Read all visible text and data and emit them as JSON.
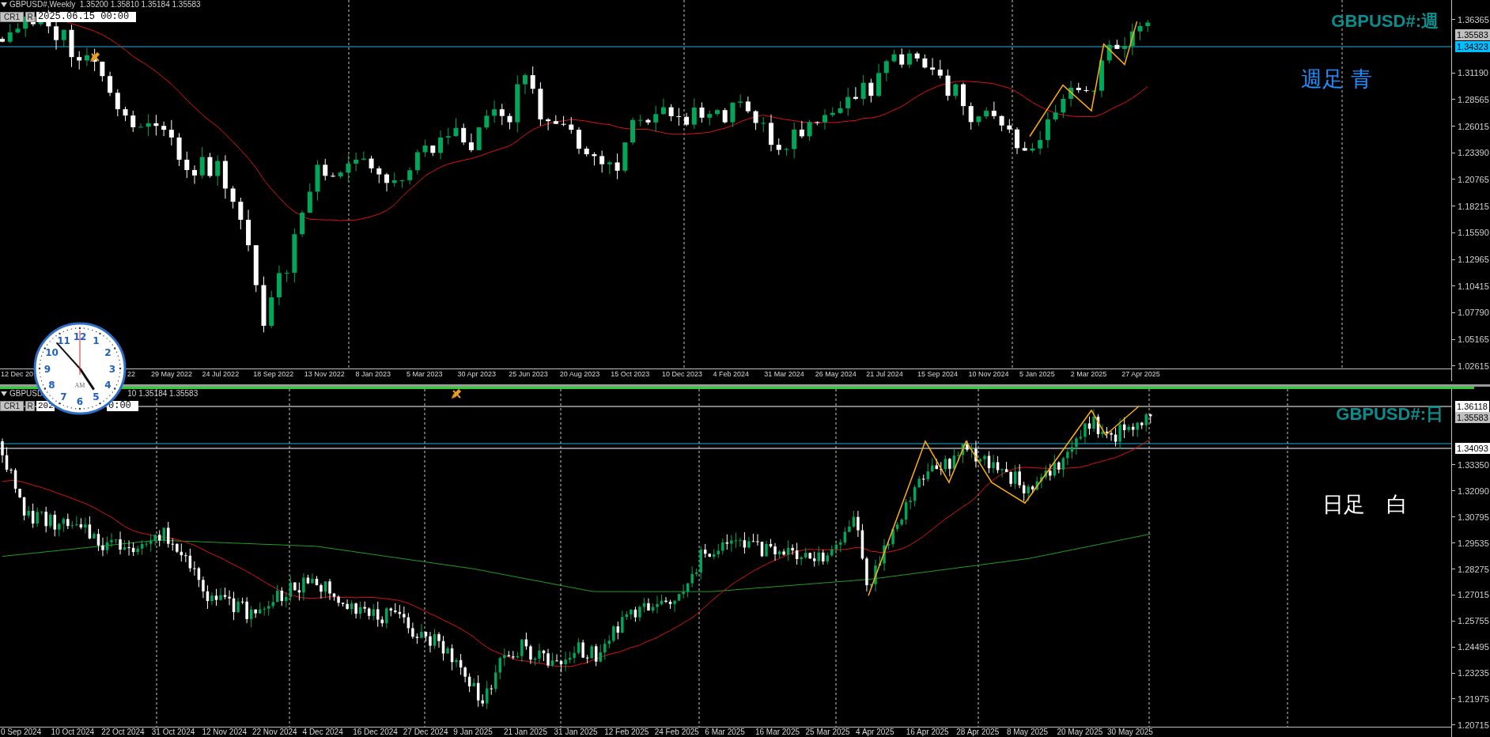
{
  "top_chart": {
    "header": "GBPUSD#,Weekly  1.35200 1.35810 1.35184 1.35583",
    "buttons": [
      "CR1",
      "R"
    ],
    "date_field": "2025.06.15 00:00",
    "symbol_label": "GBPUSD#:週",
    "note": "週足 青",
    "price_ticks": [
      "1.36365",
      "1.31190",
      "1.28565",
      "1.26015",
      "1.23390",
      "1.20765",
      "1.18215",
      "1.15590",
      "1.12965",
      "1.10415",
      "1.07790",
      "1.05165",
      "1.02615"
    ],
    "price_badges": [
      {
        "text": "1.35583",
        "kind": "bid"
      },
      {
        "text": "1.34323",
        "kind": "line"
      }
    ],
    "time_labels": [
      "12 Dec 20",
      "22",
      "29 May 2022",
      "24 Jul 2022",
      "18 Sep 2022",
      "13 Nov 2022",
      "8 Jan 2023",
      "5 Mar 2023",
      "30 Apr 2023",
      "25 Jun 2023",
      "20 Aug 2023",
      "15 Oct 2023",
      "10 Dec 2023",
      "4 Feb 2024",
      "31 Mar 2024",
      "26 May 2024",
      "21 Jul 2024",
      "15 Sep 2024",
      "10 Nov 2024",
      "5 Jan 2025",
      "2 Mar 2025",
      "27 Apr 2025"
    ]
  },
  "bottom_chart": {
    "header_parts": [
      "GBPUSD",
      "10 1.35184 1.35583"
    ],
    "buttons": [
      "CR1",
      "R"
    ],
    "date_parts": [
      "202",
      "0:00"
    ],
    "symbol_label": "GBPUSD#:日",
    "note": "日足　白",
    "price_ticks": [
      "1.33350",
      "1.32090",
      "1.30795",
      "1.29535",
      "1.28275",
      "1.27015",
      "1.25755",
      "1.24495",
      "1.23235",
      "1.21975",
      "1.20715"
    ],
    "price_badges": [
      {
        "text": "1.36118",
        "kind": "level"
      },
      {
        "text": "1.35583",
        "kind": "bid"
      },
      {
        "text": "1.34093",
        "kind": "level"
      }
    ],
    "time_labels": [
      "0 Sep 2024",
      "10 Oct 2024",
      "22 Oct 2024",
      "31 Oct 2024",
      "12 Nov 2024",
      "22 Nov 2024",
      "4 Dec 2024",
      "16 Dec 2024",
      "27 Dec 2024",
      "9 Jan 2025",
      "21 Jan 2025",
      "31 Jan 2025",
      "12 Feb 2025",
      "24 Feb 2025",
      "6 Mar 2025",
      "16 Mar 2025",
      "25 Mar 2025",
      "4 Apr 2025",
      "16 Apr 2025",
      "28 Apr 2025",
      "8 May 2025",
      "20 May 2025",
      "30 May 2025"
    ]
  },
  "clock": {
    "numerals": [
      "12",
      "11",
      "1",
      "10",
      "2",
      "9",
      "3",
      "8",
      "4",
      "7",
      "5",
      "6"
    ],
    "period": "AM"
  }
}
